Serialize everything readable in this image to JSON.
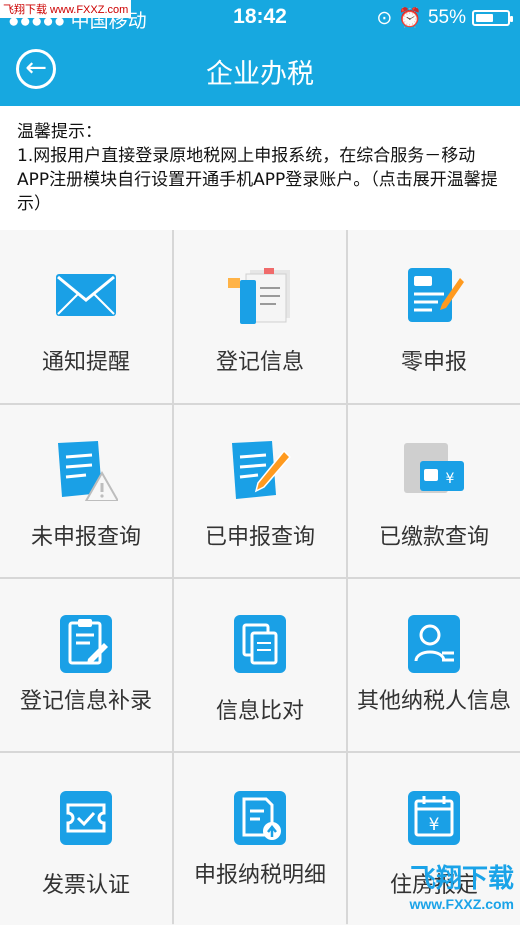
{
  "statusbar": {
    "watermark": "飞翔下载 www.FXXZ.com",
    "carrier": "●●●●● 中国移动",
    "wifi": "((·",
    "time": "18:42",
    "battery_text": "55%",
    "battery_level": 0.55
  },
  "nav": {
    "back_icon": "back-arrow-icon",
    "title": "企业办税"
  },
  "notice": {
    "heading": "温馨提示：",
    "body": "1.网报用户直接登录原地税网上申报系统，在综合服务－移动APP注册模块自行设置开通手机APP登录账户。（点击展开温馨提示）"
  },
  "menu": [
    {
      "label": "通知提醒",
      "icon": "envelope-icon"
    },
    {
      "label": "登记信息",
      "icon": "documents-icon"
    },
    {
      "label": "零申报",
      "icon": "declaration-pen-icon"
    },
    {
      "label": "未申报查询",
      "icon": "unfiled-warning-icon"
    },
    {
      "label": "已申报查询",
      "icon": "filed-pencil-icon"
    },
    {
      "label": "已缴款查询",
      "icon": "paid-card-icon"
    },
    {
      "label": "登记信息补录",
      "icon": "clipboard-edit-icon"
    },
    {
      "label": "信息比对",
      "icon": "compare-copy-icon"
    },
    {
      "label": "其他纳税人信息",
      "icon": "person-card-icon"
    },
    {
      "label": "发票认证",
      "icon": "ticket-check-icon"
    },
    {
      "label": "申报纳税明细",
      "icon": "report-upload-icon"
    },
    {
      "label": "住房报定",
      "icon": "calendar-yuan-icon"
    }
  ],
  "watermark_footer": {
    "brand": "飞翔下载",
    "url": "www.FXXZ.com"
  },
  "colors": {
    "accent": "#17a8e0",
    "icon_blue": "#1aa0e6",
    "icon_gray": "#cfcfcf"
  }
}
